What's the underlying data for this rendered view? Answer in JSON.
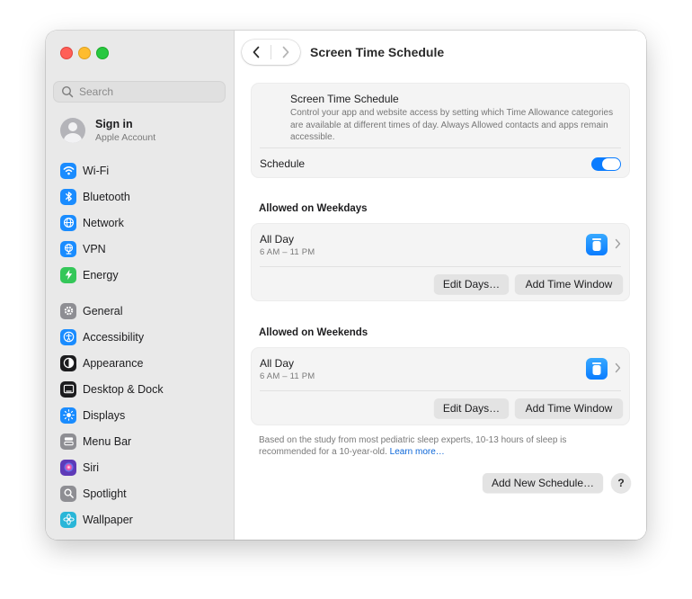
{
  "window": {
    "title": "Screen Time Schedule"
  },
  "sidebar": {
    "search_placeholder": "Search",
    "account": {
      "name": "Sign in",
      "subtitle": "Apple Account"
    },
    "group1": [
      {
        "label": "Wi-Fi",
        "icon": "wifi-icon",
        "color": "#1a8cff"
      },
      {
        "label": "Bluetooth",
        "icon": "bluetooth-icon",
        "color": "#1a8cff"
      },
      {
        "label": "Network",
        "icon": "globe-icon",
        "color": "#1a8cff"
      },
      {
        "label": "VPN",
        "icon": "vpn-globe-icon",
        "color": "#1a8cff"
      },
      {
        "label": "Energy",
        "icon": "bolt-icon",
        "color": "#34c759"
      }
    ],
    "group2": [
      {
        "label": "General",
        "icon": "gear-icon",
        "color": "#8e8e93"
      },
      {
        "label": "Accessibility",
        "icon": "accessibility-icon",
        "color": "#1a8cff"
      },
      {
        "label": "Appearance",
        "icon": "appearance-icon",
        "color": "#1c1c1e"
      },
      {
        "label": "Desktop & Dock",
        "icon": "dock-icon",
        "color": "#1c1c1e"
      },
      {
        "label": "Displays",
        "icon": "sun-icon",
        "color": "#1a8cff"
      },
      {
        "label": "Menu Bar",
        "icon": "menubar-icon",
        "color": "#8e8e93"
      },
      {
        "label": "Siri",
        "icon": "siri-icon",
        "color": "#5e3ab8"
      },
      {
        "label": "Spotlight",
        "icon": "magnifier-icon",
        "color": "#8e8e93"
      },
      {
        "label": "Wallpaper",
        "icon": "flower-icon",
        "color": "#29b6d8"
      }
    ]
  },
  "intro": {
    "title": "Screen Time Schedule",
    "description": "Control your app and website access by setting which Time Allowance categories are available at different times of day. Always Allowed contacts and apps remain accessible.",
    "schedule_label": "Schedule",
    "schedule_on": true
  },
  "weekdays": {
    "title": "Allowed on Weekdays",
    "row_label": "All Day",
    "time": "6 AM – 11 PM",
    "edit_days": "Edit Days…",
    "add_window": "Add Time Window"
  },
  "weekends": {
    "title": "Allowed on Weekends",
    "row_label": "All Day",
    "time": "6 AM – 11 PM",
    "edit_days": "Edit Days…",
    "add_window": "Add Time Window"
  },
  "footer": {
    "note": "Based on the study from most pediatric sleep experts, 10-13 hours of sleep is recommended for a 10-year-old.",
    "learn_more": "Learn more…",
    "add_schedule": "Add New Schedule…",
    "help": "?"
  },
  "colors": {
    "accent": "#0a7cff",
    "sidebar_bg": "#e9e9e9"
  }
}
